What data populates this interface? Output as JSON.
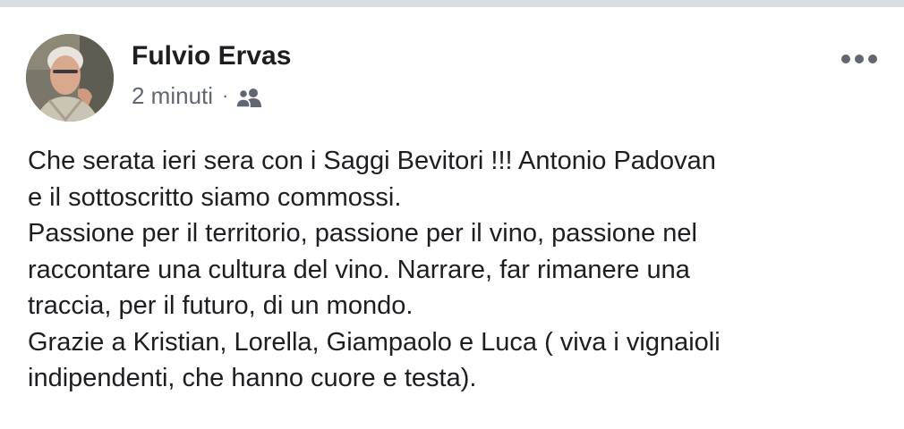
{
  "post": {
    "author": "Fulvio Ervas",
    "timestamp": "2 minuti",
    "separator": "·",
    "audience_icon": "friends-icon",
    "menu_icon": "more-options-icon",
    "lines": [
      "Che serata ieri sera con i Saggi Bevitori !!!  Antonio Padovan",
      "e il sottoscritto siamo commossi.",
      "Passione per il territorio, passione per il vino, passione nel",
      "raccontare una cultura del vino. Narrare, far rimanere una",
      "traccia, per il futuro, di un mondo.",
      "Grazie a Kristian, Lorella, Giampaolo e Luca ( viva i vignaioli",
      "indipendenti, che hanno cuore e testa)."
    ]
  },
  "colors": {
    "text_primary": "#1c1e21",
    "text_secondary": "#606770",
    "top_bar": "#dadde1"
  }
}
